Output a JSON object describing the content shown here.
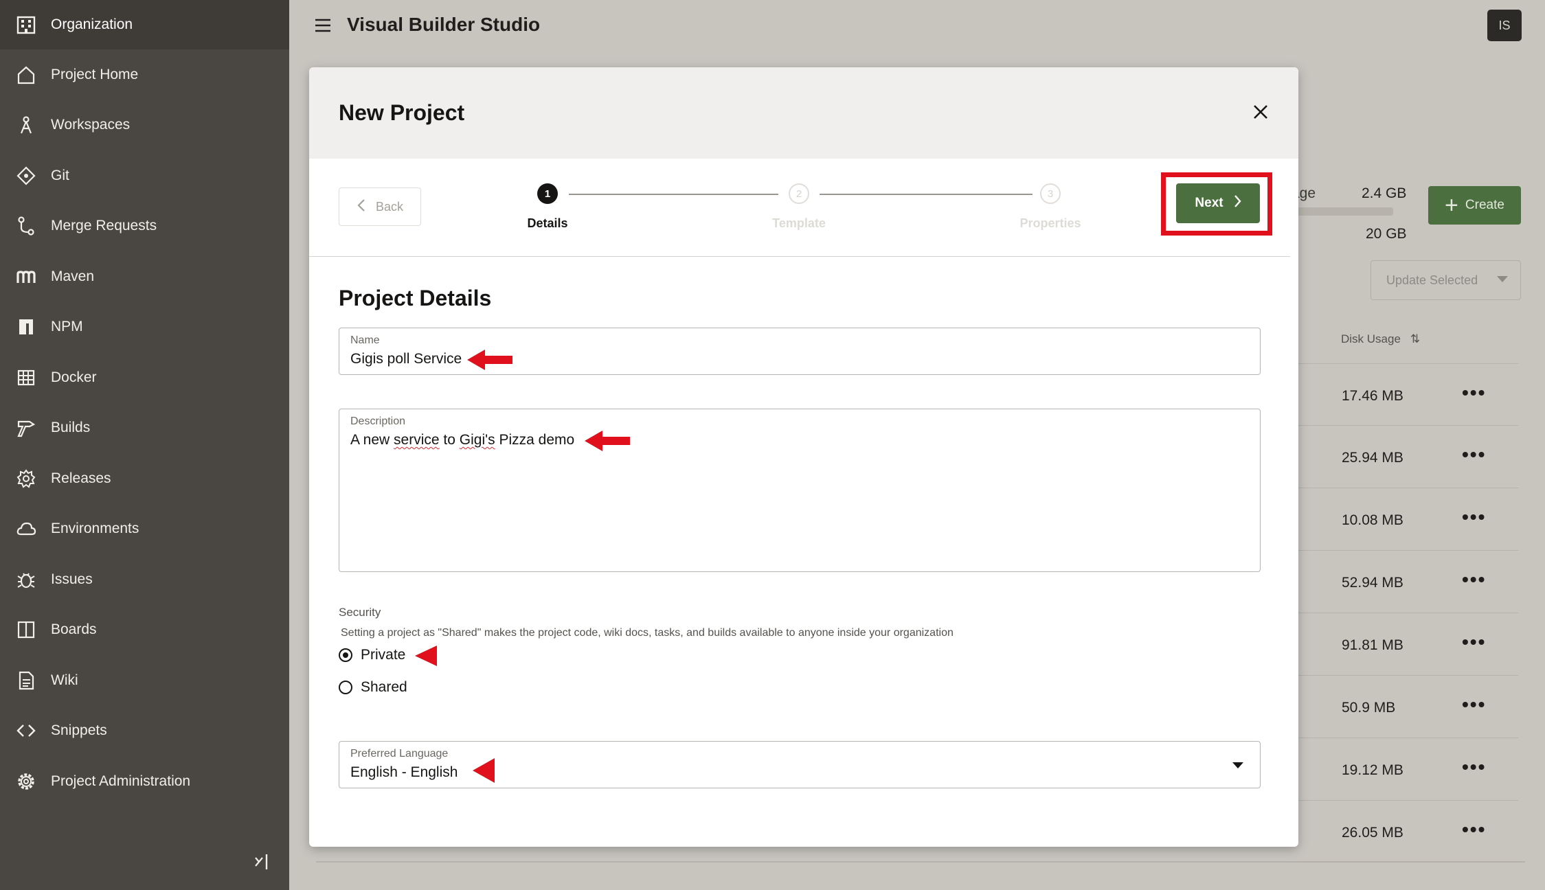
{
  "sidebar": {
    "org_label": "Organization",
    "items": [
      {
        "label": "Project Home",
        "icon": "home-icon"
      },
      {
        "label": "Workspaces",
        "icon": "workspaces-icon"
      },
      {
        "label": "Git",
        "icon": "git-icon"
      },
      {
        "label": "Merge Requests",
        "icon": "merge-icon"
      },
      {
        "label": "Maven",
        "icon": "maven-icon"
      },
      {
        "label": "NPM",
        "icon": "npm-icon"
      },
      {
        "label": "Docker",
        "icon": "docker-icon"
      },
      {
        "label": "Builds",
        "icon": "builds-icon"
      },
      {
        "label": "Releases",
        "icon": "releases-icon"
      },
      {
        "label": "Environments",
        "icon": "cloud-icon"
      },
      {
        "label": "Issues",
        "icon": "bug-icon"
      },
      {
        "label": "Boards",
        "icon": "boards-icon"
      },
      {
        "label": "Wiki",
        "icon": "wiki-icon"
      },
      {
        "label": "Snippets",
        "icon": "code-icon"
      },
      {
        "label": "Project Administration",
        "icon": "gear-icon"
      }
    ]
  },
  "header": {
    "title": "Visual Builder Studio",
    "avatar_initials": "IS"
  },
  "background": {
    "storage_label": "age",
    "storage_used": "2.4 GB",
    "storage_total": "20 GB",
    "create_label": "Create",
    "update_selected_label": "Update Selected",
    "disk_usage_header": "Disk Usage",
    "rows": [
      "17.46 MB",
      "25.94 MB",
      "10.08 MB",
      "52.94 MB",
      "91.81 MB",
      "50.9 MB",
      "19.12 MB",
      "26.05 MB"
    ]
  },
  "dialog": {
    "title": "New Project",
    "back_label": "Back",
    "next_label": "Next",
    "steps": [
      {
        "number": "1",
        "label": "Details"
      },
      {
        "number": "2",
        "label": "Template"
      },
      {
        "number": "3",
        "label": "Properties"
      }
    ],
    "section_title": "Project Details",
    "name": {
      "label": "Name",
      "value": "Gigis poll Service"
    },
    "description": {
      "label": "Description",
      "value_parts": [
        "A new ",
        "service",
        " to ",
        "Gigi's",
        " Pizza demo"
      ]
    },
    "security": {
      "label": "Security",
      "help": "Setting a project as \"Shared\" makes the project code, wiki docs, tasks, and builds available to anyone inside your organization",
      "options": [
        "Private",
        "Shared"
      ],
      "selected": "Private"
    },
    "language": {
      "label": "Preferred Language",
      "value": "English - English"
    }
  },
  "colors": {
    "accent_green": "#4b6f3f",
    "annotation_red": "#e0101c",
    "sidebar_bg": "#4a4641"
  }
}
